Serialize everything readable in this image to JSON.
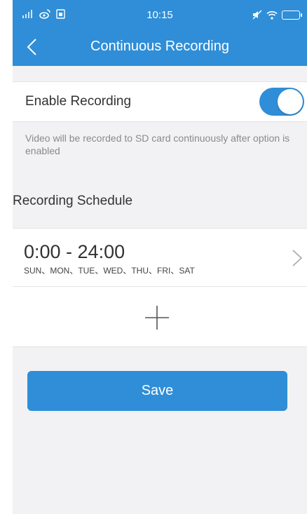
{
  "status_bar": {
    "time": "10:15",
    "icons": [
      "signal-icon",
      "weibo-icon",
      "sim-icon",
      "mute-icon",
      "wifi-icon",
      "battery-icon"
    ]
  },
  "nav": {
    "title": "Continuous Recording",
    "back_icon": "chevron-left-icon"
  },
  "enable": {
    "label": "Enable Recording",
    "enabled": true,
    "hint": "Video will be recorded to SD card continuously after option is enabled"
  },
  "schedule": {
    "heading": "Recording Schedule",
    "items": [
      {
        "time_range": "0:00 - 24:00",
        "days": "SUN、MON、TUE、WED、THU、FRI、SAT"
      }
    ],
    "add_icon": "plus-icon"
  },
  "save_label": "Save",
  "colors": {
    "accent": "#2f8ed7",
    "background": "#f2f2f4",
    "hint_text": "#8a8a8a"
  }
}
